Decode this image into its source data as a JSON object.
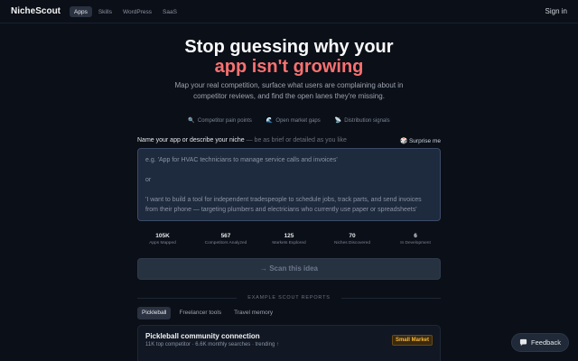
{
  "nav": {
    "brand": "NicheScout",
    "tabs": [
      {
        "label": "Apps",
        "active": true
      },
      {
        "label": "Skills",
        "active": false
      },
      {
        "label": "WordPress",
        "active": false
      },
      {
        "label": "SaaS",
        "active": false
      }
    ],
    "signin": "Sign in"
  },
  "hero": {
    "title_line1": "Stop guessing why your",
    "title_line2": "app isn't growing",
    "subtitle": "Map your real competition, surface what users are complaining about in competitor reviews, and find the open lanes they're missing.",
    "features": [
      {
        "icon": "🔍",
        "icon_name": "magnifier-icon",
        "label": "Competitor pain points"
      },
      {
        "icon": "🌊",
        "icon_name": "wave-icon",
        "label": "Open market gaps"
      },
      {
        "icon": "📡",
        "icon_name": "satellite-icon",
        "label": "Distribution signals"
      }
    ]
  },
  "input": {
    "label": "Name your app or describe your niche",
    "hint": " — be as brief or detailed as you like",
    "surprise_icon": "🎲",
    "surprise_label": "Surprise me",
    "placeholder": "e.g. 'App for HVAC technicians to manage service calls and invoices'\n\nor\n\n'I want to build a tool for independent tradespeople to schedule jobs, track parts, and send invoices from their phone — targeting plumbers and electricians who currently use paper or spreadsheets'"
  },
  "stats": [
    {
      "value": "105K",
      "label": "Apps Mapped"
    },
    {
      "value": "567",
      "label": "Competitors Analyzed"
    },
    {
      "value": "125",
      "label": "Markets Explored"
    },
    {
      "value": "70",
      "label": "Niches Discovered"
    },
    {
      "value": "6",
      "label": "In Development"
    }
  ],
  "scan_button": "→ Scan this idea",
  "examples": {
    "heading": "EXAMPLE SCOUT REPORTS",
    "tabs": [
      {
        "label": "Pickleball",
        "active": true
      },
      {
        "label": "Freelancer tools",
        "active": false
      },
      {
        "label": "Travel memory",
        "active": false
      }
    ],
    "card": {
      "title": "Pickleball community connection",
      "meta": "11K top competitor · 6.6K monthly searches · trending ↑",
      "badge": "Small Market"
    }
  },
  "feedback": {
    "label": "Feedback"
  },
  "colors": {
    "background": "#0b0f17",
    "accent": "#f87171",
    "badge": "#f5b63c",
    "input_bg": "#1e2a3d"
  }
}
